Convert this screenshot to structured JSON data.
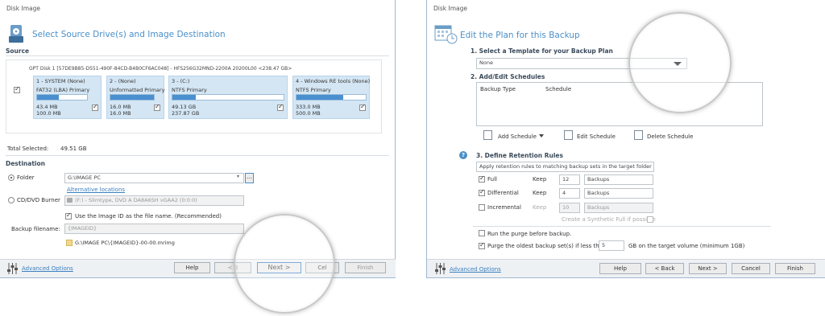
{
  "left": {
    "window_title": "Disk Image",
    "heading": "Select Source Drive(s) and Image Destination",
    "source_label": "Source",
    "disk_header": "GPT Disk 1 [57DE9B85-D551-490F-84CD-B4B0CF6AC048] - HFS256G32MND-2200A 20200L00 <238.47 GB>",
    "partitions": [
      {
        "name": "1 - SYSTEM (None)",
        "fs": "FAT32 (LBA) Primary",
        "used": "43.4 MB",
        "total": "100.0 MB",
        "fill": 0.43
      },
      {
        "name": "2 - (None)",
        "fs": "Unformatted Primary",
        "used": "16.0 MB",
        "total": "16.0 MB",
        "fill": 1.0
      },
      {
        "name": "3 - (C:)",
        "fs": "NTFS Primary",
        "used": "49.13 GB",
        "total": "237.87 GB",
        "fill": 0.21
      },
      {
        "name": "4 - Windows RE tools (None)",
        "fs": "NTFS Primary",
        "used": "333.0 MB",
        "total": "500.0 MB",
        "fill": 0.67
      }
    ],
    "total_selected_label": "Total Selected:",
    "total_selected_value": "49.51 GB",
    "destination_label": "Destination",
    "folder_label": "Folder",
    "folder_path": "G:\\IMAGE PC",
    "alternative_locations": "Alternative locations",
    "cd_dvd_label": "CD/DVD Burner",
    "cd_dvd_device": "(F:) - Slimtype, DVD A  DA8A6SH  vGAA2 (0:0:0)",
    "use_image_id_label": "Use the Image ID as the file name.  (Recommended)",
    "backup_filename_label": "Backup filename:",
    "backup_filename_value": "{IMAGEID}",
    "output_path": "G:\\IMAGE PC\\{IMAGEID}-00-00.mrimg",
    "advanced_options": "Advanced Options",
    "buttons": {
      "help": "Help",
      "back": "< B",
      "next": "Next >",
      "cancel": "Cel",
      "finish": "Finish"
    }
  },
  "right": {
    "window_title": "Disk Image",
    "heading": "Edit the Plan for this Backup",
    "step1": "1. Select a Template for your Backup Plan",
    "template_value": "None",
    "step2": "2. Add/Edit Schedules",
    "col_backup_type": "Backup Type",
    "col_schedule": "Schedule",
    "add_schedule": "Add Schedule",
    "edit_schedule": "Edit Schedule",
    "delete_schedule": "Delete Schedule",
    "step3": "3. Define Retention Rules",
    "retention_mode": "Apply retention rules to matching backup sets in the target folder",
    "rules": [
      {
        "label": "Full",
        "keep_label": "Keep",
        "count": "12",
        "unit": "Backups",
        "checked": true,
        "enabled": true
      },
      {
        "label": "Differential",
        "keep_label": "Keep",
        "count": "4",
        "unit": "Backups",
        "checked": true,
        "enabled": true
      },
      {
        "label": "Incremental",
        "keep_label": "Keep",
        "count": "10",
        "unit": "Backups",
        "checked": false,
        "enabled": false
      }
    ],
    "synthetic_full": "Create a Synthetic Full if possible",
    "purge_before": "Run the purge before backup.",
    "purge_oldest": "Purge the oldest backup set(s) if less than",
    "purge_gb": "5",
    "purge_suffix": "GB on the target volume (minimum 1GB)",
    "advanced_options": "Advanced Options",
    "buttons": {
      "help": "Help",
      "back": "< Back",
      "next": "Next >",
      "cancel": "Cancel",
      "finish": "Finish"
    }
  },
  "colors": {
    "accent": "#4a8fc8",
    "partition_bg": "#d4e6f4",
    "bar_fill": "#4a90d0",
    "footer_bg": "#eef1f4"
  }
}
